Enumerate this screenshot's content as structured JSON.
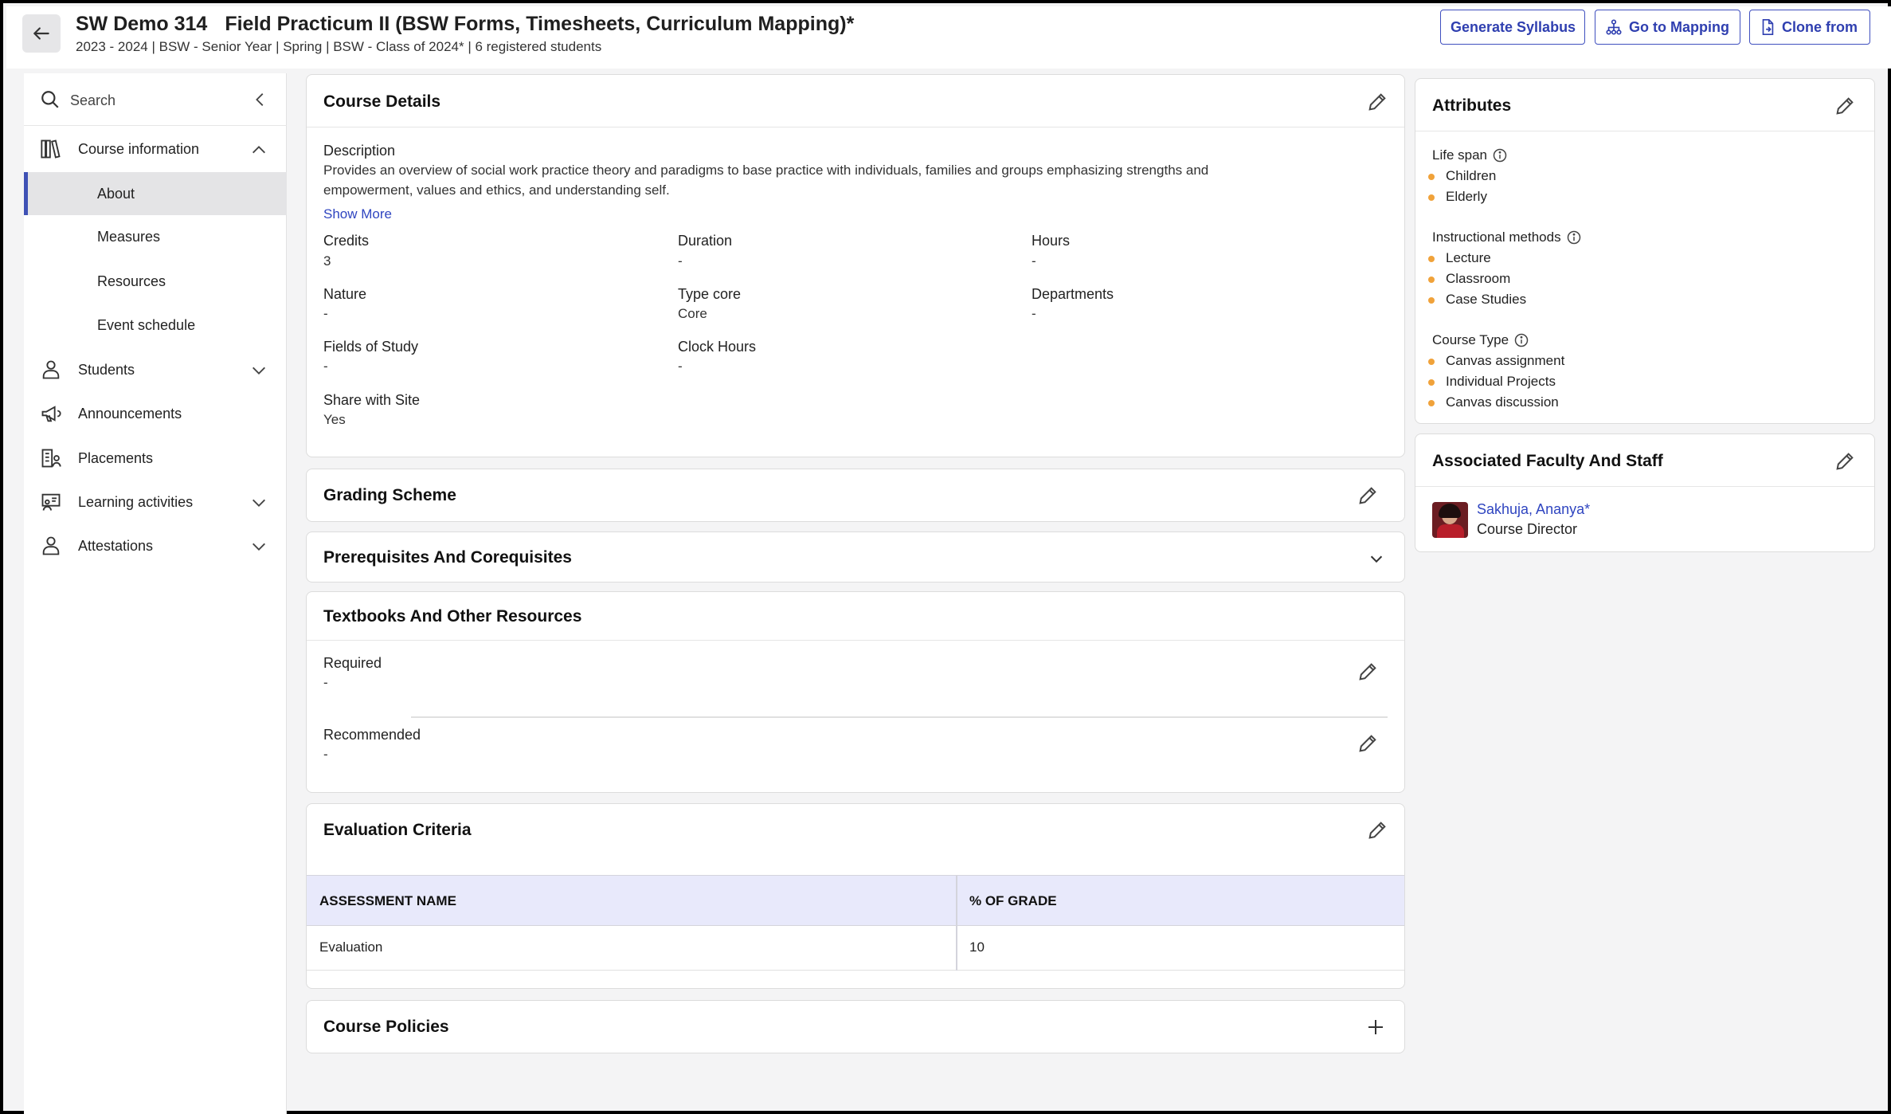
{
  "header": {
    "course_code": "SW Demo 314",
    "course_title": "Field Practicum II (BSW Forms, Timesheets, Curriculum Mapping)*",
    "subtitle": "2023 - 2024 | BSW - Senior Year | Spring | BSW - Class of 2024* | 6 registered students",
    "buttons": {
      "generate_syllabus": "Generate Syllabus",
      "go_to_mapping": "Go to Mapping",
      "clone_from": "Clone from"
    }
  },
  "sidebar": {
    "search_placeholder": "Search",
    "items": [
      {
        "label": "Course information",
        "expanded": true,
        "icon": "books-icon"
      },
      {
        "label": "Students",
        "icon": "person-icon"
      },
      {
        "label": "Announcements",
        "icon": "megaphone-icon"
      },
      {
        "label": "Placements",
        "icon": "placements-icon"
      },
      {
        "label": "Learning activities",
        "icon": "presentation-icon"
      },
      {
        "label": "Attestations",
        "icon": "person-icon"
      }
    ],
    "sub_items": [
      "About",
      "Measures",
      "Resources",
      "Event schedule"
    ],
    "active_sub_item": "About"
  },
  "course_details": {
    "title": "Course Details",
    "description_label": "Description",
    "description_line1": "Provides an overview of social work practice theory and paradigms to base practice with individuals, families and groups emphasizing strengths and",
    "description_line2": "empowerment, values and ethics, and understanding self.",
    "show_more": "Show More",
    "fields": {
      "credits": {
        "label": "Credits",
        "value": "3"
      },
      "duration": {
        "label": "Duration",
        "value": "-"
      },
      "hours": {
        "label": "Hours",
        "value": "-"
      },
      "nature": {
        "label": "Nature",
        "value": "-"
      },
      "type_core": {
        "label": "Type core",
        "value": "Core"
      },
      "departments": {
        "label": "Departments",
        "value": "-"
      },
      "fields_of_study": {
        "label": "Fields of Study",
        "value": "-"
      },
      "clock_hours": {
        "label": "Clock Hours",
        "value": "-"
      },
      "share_with_site": {
        "label": "Share with Site",
        "value": "Yes"
      }
    }
  },
  "grading_scheme": {
    "title": "Grading Scheme"
  },
  "prerequisites": {
    "title": "Prerequisites And Corequisites"
  },
  "textbooks": {
    "title": "Textbooks And Other Resources",
    "required_label": "Required",
    "required_value": "-",
    "recommended_label": "Recommended",
    "recommended_value": "-"
  },
  "evaluation": {
    "title": "Evaluation Criteria",
    "columns": [
      "ASSESSMENT NAME",
      "% OF GRADE"
    ],
    "rows": [
      [
        "Evaluation",
        "10"
      ]
    ]
  },
  "course_policies": {
    "title": "Course Policies"
  },
  "attributes": {
    "title": "Attributes",
    "groups": [
      {
        "label": "Life span",
        "items": [
          "Children",
          "Elderly"
        ]
      },
      {
        "label": "Instructional methods",
        "items": [
          "Lecture",
          "Classroom",
          "Case Studies"
        ]
      },
      {
        "label": "Course Type",
        "items": [
          "Canvas assignment",
          "Individual Projects",
          "Canvas discussion"
        ]
      }
    ]
  },
  "faculty": {
    "title": "Associated Faculty And Staff",
    "name": "Sakhuja, Ananya*",
    "role": "Course Director"
  },
  "colors": {
    "accent": "#3f51b5",
    "bullet": "#f0a23a",
    "table_header": "#e8e9fb"
  }
}
